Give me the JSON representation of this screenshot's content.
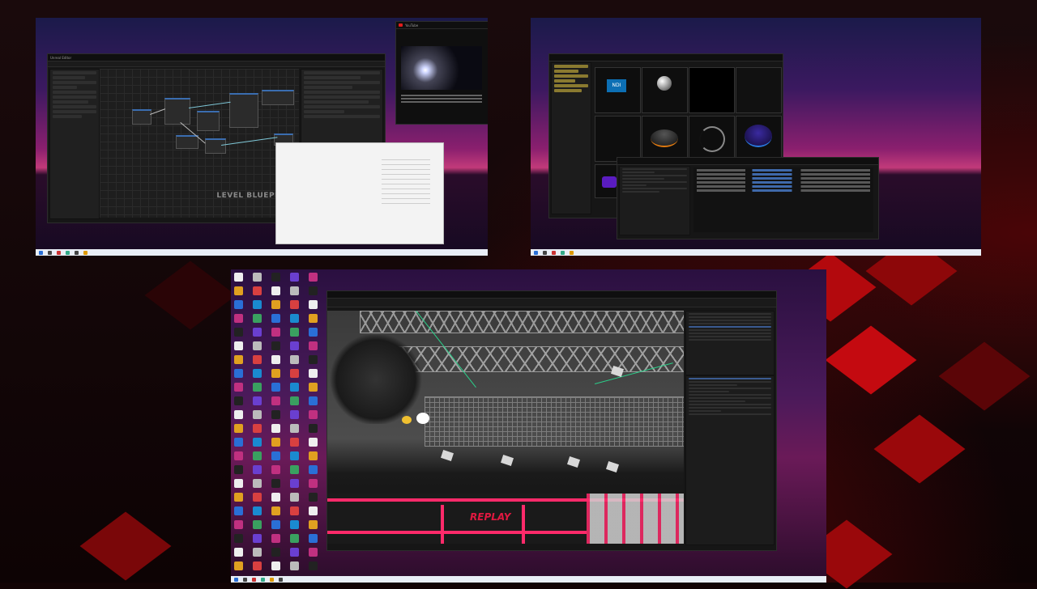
{
  "monitor_1": {
    "editor_title": "Unreal Editor",
    "graph_watermark": "LEVEL BLUEPRINT",
    "browser": {
      "site": "YouTube",
      "caption_lines": 2
    },
    "explorer_popup": true
  },
  "monitor_2": {
    "content_browser": {
      "thumb_labels": [
        "NDI"
      ]
    },
    "output_log": true
  },
  "monitor_3": {
    "viewport_text": "REPLAY",
    "desktop_icon_columns": 5
  },
  "colors": {
    "accent_red": "#e01840",
    "wallpaper_purple": "#3b1960",
    "wallpaper_pink": "#c23a7a",
    "editor_dark": "#161616",
    "stage_pink": "#ff2a6a"
  }
}
